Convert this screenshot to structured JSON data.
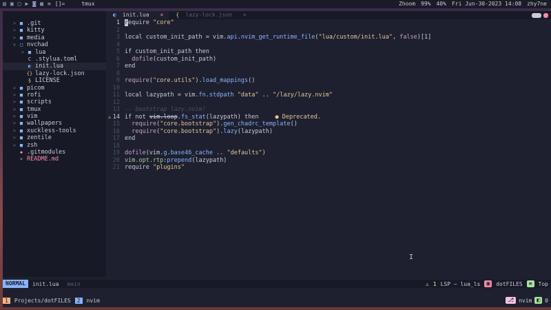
{
  "topbar": {
    "left_icons": [
      "terminal-icon",
      "folder-icon",
      "files-icon",
      "video-icon",
      "camera-icon",
      "grid-icon",
      "bars-icon"
    ],
    "layout": "[]=",
    "tmux_label": "tmux",
    "zoom": "Zhoom",
    "battery": "99%",
    "volume": "40%",
    "datetime": "Fri Jun-30-2023 14:08",
    "user": "zhy7ne"
  },
  "tree": {
    "items": [
      {
        "arrow": ">",
        "icon": "■",
        "color": "#89b4fa",
        "label": ".git",
        "indent": 0
      },
      {
        "arrow": ">",
        "icon": "■",
        "color": "#89b4fa",
        "label": "kitty",
        "indent": 0
      },
      {
        "arrow": ">",
        "icon": "■",
        "color": "#89b4fa",
        "label": "media",
        "indent": 0
      },
      {
        "arrow": "v",
        "icon": "□",
        "color": "#89b4fa",
        "label": "nvchad",
        "indent": 0
      },
      {
        "arrow": ">",
        "icon": "■",
        "color": "#89b4fa",
        "label": "lua",
        "indent": 1
      },
      {
        "arrow": "",
        "icon": "C",
        "color": "#c8ccd4",
        "label": ".stylua.toml",
        "indent": 1
      },
      {
        "arrow": "",
        "icon": "◐",
        "color": "#89b4fa",
        "label": "init.lua",
        "indent": 1,
        "selected": true
      },
      {
        "arrow": "",
        "icon": "{}",
        "color": "#e5c890",
        "label": "lazy-lock.json",
        "indent": 1
      },
      {
        "arrow": "",
        "icon": "§",
        "color": "#e5c890",
        "label": "LICENSE",
        "indent": 1
      },
      {
        "arrow": ">",
        "icon": "■",
        "color": "#89b4fa",
        "label": "picom",
        "indent": 0
      },
      {
        "arrow": ">",
        "icon": "■",
        "color": "#89b4fa",
        "label": "rofi",
        "indent": 0
      },
      {
        "arrow": ">",
        "icon": "■",
        "color": "#89b4fa",
        "label": "scripts",
        "indent": 0
      },
      {
        "arrow": ">",
        "icon": "■",
        "color": "#89b4fa",
        "label": "tmux",
        "indent": 0
      },
      {
        "arrow": ">",
        "icon": "■",
        "color": "#89b4fa",
        "label": "vim",
        "indent": 0
      },
      {
        "arrow": ">",
        "icon": "■",
        "color": "#89b4fa",
        "label": "wallpapers",
        "indent": 0
      },
      {
        "arrow": ">",
        "icon": "■",
        "color": "#89b4fa",
        "label": "xuckless-tools",
        "indent": 0
      },
      {
        "arrow": ">",
        "icon": "■",
        "color": "#89b4fa",
        "label": "zentile",
        "indent": 0
      },
      {
        "arrow": ">",
        "icon": "■",
        "color": "#89b4fa",
        "label": "zsh",
        "indent": 0
      },
      {
        "arrow": "",
        "icon": "◆",
        "color": "#f38ba8",
        "label": ".gitmodules",
        "indent": 0
      },
      {
        "arrow": "",
        "icon": "×",
        "color": "#f38ba8",
        "label": "README.md",
        "indent": 0,
        "labelColor": "#f38ba8"
      }
    ]
  },
  "tabs": [
    {
      "label": "init.lua",
      "active": true,
      "close": "×"
    },
    {
      "label": "lazy-lock.json",
      "active": false,
      "close": "×"
    }
  ],
  "editor": {
    "lines": [
      {
        "n": "1",
        "html": "<span class='cursor'>r</span>equire <span class='s'>\"core\"</span>"
      },
      {
        "n": "2",
        "html": ""
      },
      {
        "n": "3",
        "html": "local custom_init_path = vim.<span class='m'>api</span>.<span class='m'>nvim_get_runtime_file</span>(<span class='s'>\"lua/custom/init.lua\"</span>, <span class='f'>false</span>)[1]"
      },
      {
        "n": "4",
        "html": ""
      },
      {
        "n": "5",
        "html": "if custom_init_path then"
      },
      {
        "n": "6",
        "html": "  <span class='f'>dofile</span>(custom_init_path)"
      },
      {
        "n": "7",
        "html": "end"
      },
      {
        "n": "8",
        "html": ""
      },
      {
        "n": "9",
        "html": "<span class='f'>require</span>(<span class='s'>\"core.utils\"</span>).<span class='m'>load_mappings</span>()"
      },
      {
        "n": "10",
        "html": ""
      },
      {
        "n": "11",
        "html": "local lazypath = vim.<span class='m'>fn</span>.<span class='m'>stdpath</span> <span class='s'>\"data\"</span> .. <span class='s'>\"/lazy/lazy.nvim\"</span>"
      },
      {
        "n": "12",
        "html": ""
      },
      {
        "n": "13",
        "html": "<span class='c'>-- bootstrap lazy.nvim!</span>"
      },
      {
        "n": "14",
        "html": "if not <span class='strike'>vim.loop</span>.<span class='m'>fs_stat</span>(lazypath) then<span class='diag'>● Deprecated.</span>",
        "warn": true
      },
      {
        "n": "15",
        "html": "  <span class='f'>require</span>(<span class='s'>\"core.bootstrap\"</span>).<span class='m'>gen_chadrc_template</span>()"
      },
      {
        "n": "16",
        "html": "  <span class='f'>require</span>(<span class='s'>\"core.bootstrap\"</span>).<span class='m'>lazy</span>(lazypath)"
      },
      {
        "n": "17",
        "html": "end"
      },
      {
        "n": "18",
        "html": ""
      },
      {
        "n": "19",
        "html": "<span class='f'>dofile</span>(vim.<span class='m'>g</span>.<span class='m'>base46_cache</span> .. <span class='s'>\"defaults\"</span>)"
      },
      {
        "n": "20",
        "html": "<span class='v'>vim.opt.rtp</span>:<span class='m'>prepend</span>(lazypath)"
      },
      {
        "n": "21",
        "html": "require <span class='s'>\"plugins\"</span>"
      }
    ]
  },
  "statusline": {
    "mode": "NORMAL",
    "file": "init.lua",
    "branch": "main",
    "warnings": "1",
    "lsp": "LSP ~ lua_ls",
    "cwd": "dotFILES",
    "position": "Top"
  },
  "tmuxbar": {
    "win1_num": "1",
    "win1_label": "Projects/dotFILES",
    "win2_num": "2",
    "win2_label": "nvim",
    "right_label": "nvim",
    "right_num": "0"
  },
  "colors": {
    "accent": "#89b4fa",
    "warn": "#f9e2af",
    "orange": "#fab387",
    "pink": "#f38ba8",
    "green": "#a6e3a1"
  }
}
